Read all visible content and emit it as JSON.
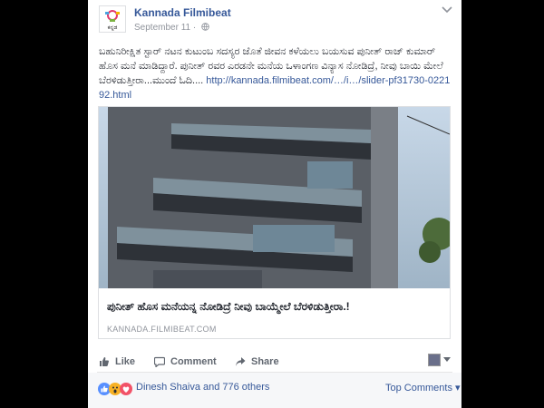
{
  "post": {
    "page_name": "Kannada Filmibeat",
    "date": "September 11 · ",
    "avatar_text": "ಕನ್ನಡ",
    "body_text": "ಬಹುನಿರೀಕ್ಷಿತ ಸ್ಟಾರ್ ನಟನ ಕುಟುಂಬ ಸದಸ್ಯರ ಜೊತೆ ಜೀವನ ಕಳೆಯಲು ಬಯಸುವ ಪುನೀತ್ ರಾಜ್ ಕುಮಾರ್ ಹೊಸ ಮನೆ ಮಾಡಿದ್ದಾರೆ. ಪುನೀತ್ ರವರ ಎರಡನೇ ಮನೆಯ ಒಳಾಂಗಣ ವಿನ್ಯಾಸ ನೋಡಿದ್ರೆ, ನೀವು ಬಾಯಿ ಮೇಲೆ ಬೆರಳಿಡುತ್ತೀರಾ...ಮುಂದೆ ಓದಿ.... ",
    "link_text": "http://kannada.filmibeat.com/…/i…/slider-pf31730-022192.html"
  },
  "attachment": {
    "title": "ಪುನೀತ್ ಹೊಸ ಮನೆಯನ್ನ ನೋಡಿದ್ರೆ ನೀವು ಬಾಯ್ಮೇಲೆ ಬೆರಳಿಡುತ್ತೀರಾ.!",
    "domain": "KANNADA.FILMIBEAT.COM"
  },
  "actions": {
    "like": "Like",
    "comment": "Comment",
    "share": "Share"
  },
  "reactions": {
    "names": "Dinesh Shaiva and 776 others",
    "top_comments": "Top Comments ▾",
    "icons": [
      "like-reaction-icon",
      "wow-reaction-icon",
      "love-reaction-icon"
    ]
  },
  "colors": {
    "link": "#365899",
    "background": "#000000",
    "card": "#ffffff"
  }
}
